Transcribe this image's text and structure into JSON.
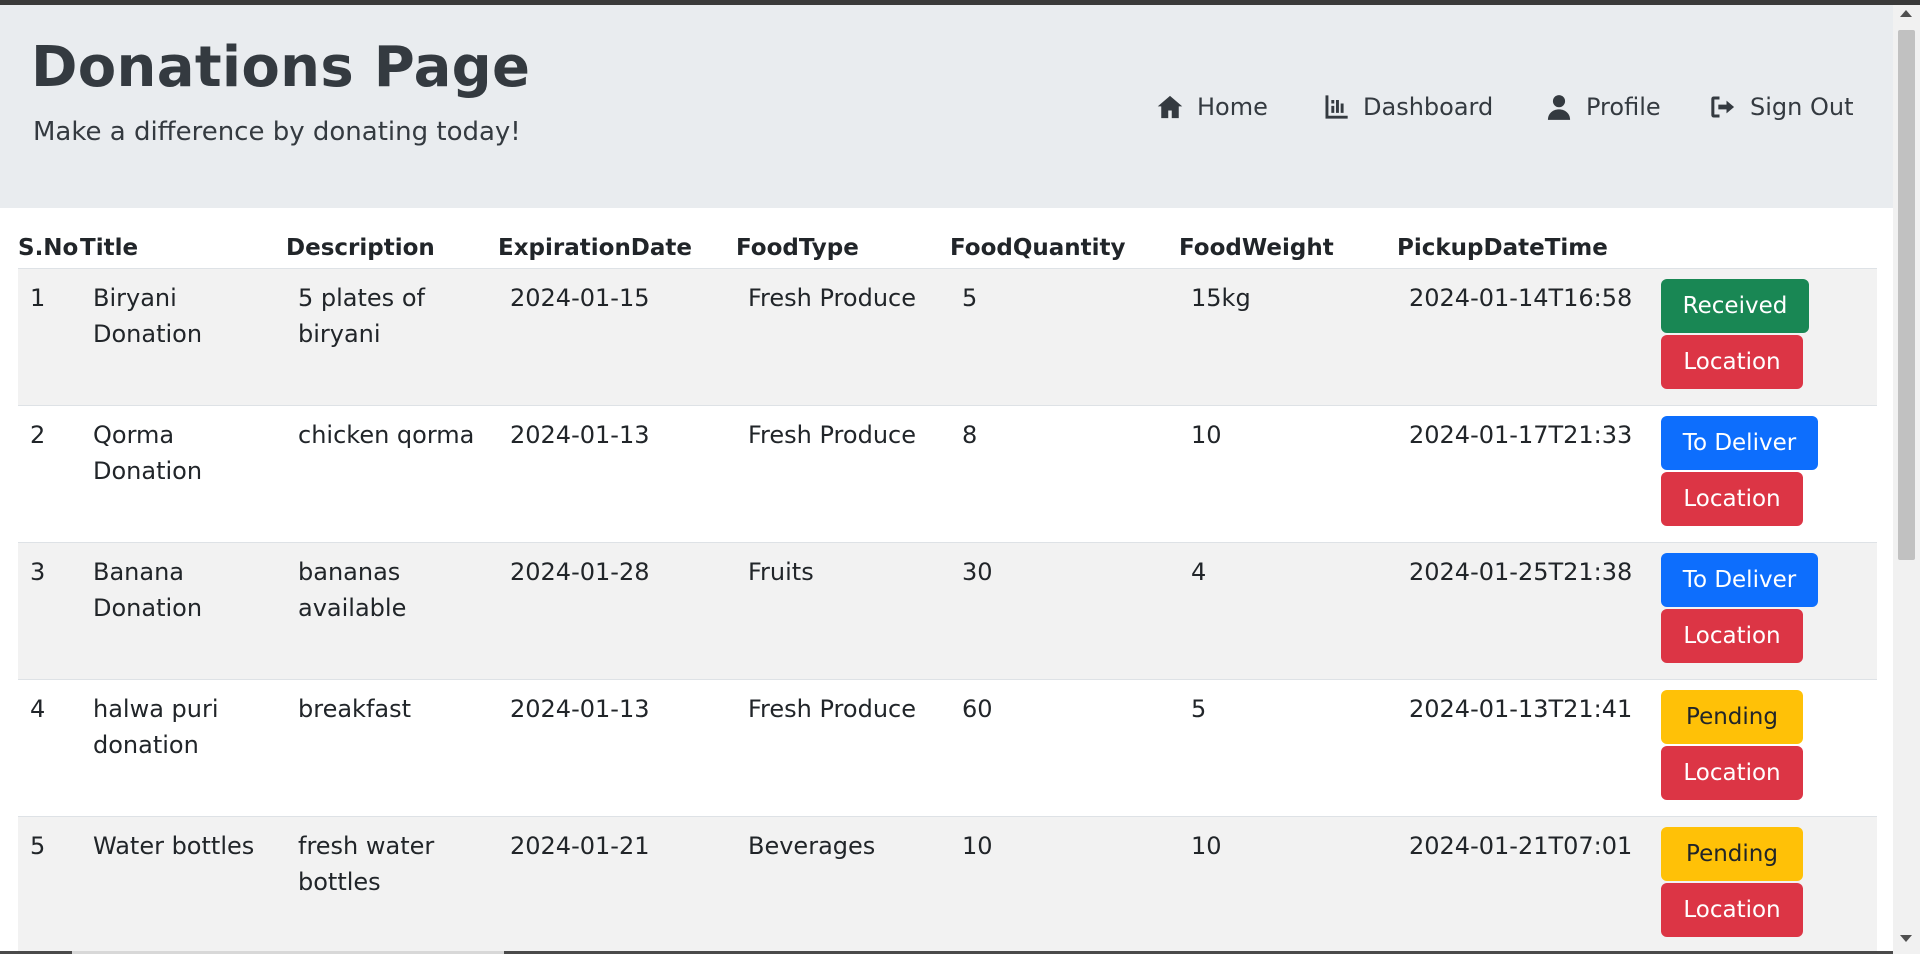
{
  "header": {
    "title": "Donations Page",
    "subtitle": "Make a difference by donating today!"
  },
  "nav": {
    "home": "Home",
    "dashboard": "Dashboard",
    "profile": "Profile",
    "signout": "Sign Out",
    "icons": [
      "home-icon",
      "chart-icon",
      "user-icon",
      "sign-out-icon"
    ]
  },
  "table": {
    "headers": [
      "S.No",
      "Title",
      "Description",
      "ExpirationDate",
      "FoodType",
      "FoodQuantity",
      "FoodWeight",
      "PickupDateTime"
    ],
    "rows": [
      {
        "sno": "1",
        "title": "Biryani Donation",
        "description": "5 plates of biryani",
        "expiration": "2024-01-15",
        "type": "Fresh Produce",
        "quantity": "5",
        "weight": "15kg",
        "pickup": "2024-01-14T16:58",
        "status": "Received",
        "location": "Location"
      },
      {
        "sno": "2",
        "title": "Qorma Donation",
        "description": "chicken qorma",
        "expiration": "2024-01-13",
        "type": "Fresh Produce",
        "quantity": "8",
        "weight": "10",
        "pickup": "2024-01-17T21:33",
        "status": "To Deliver",
        "location": "Location"
      },
      {
        "sno": "3",
        "title": "Banana Donation",
        "description": "bananas available",
        "expiration": "2024-01-28",
        "type": "Fruits",
        "quantity": "30",
        "weight": "4",
        "pickup": "2024-01-25T21:38",
        "status": "To Deliver",
        "location": "Location"
      },
      {
        "sno": "4",
        "title": "halwa puri donation",
        "description": "breakfast",
        "expiration": "2024-01-13",
        "type": "Fresh Produce",
        "quantity": "60",
        "weight": "5",
        "pickup": "2024-01-13T21:41",
        "status": "Pending",
        "location": "Location"
      },
      {
        "sno": "5",
        "title": "Water bottles",
        "description": "fresh water bottles",
        "expiration": "2024-01-21",
        "type": "Beverages",
        "quantity": "10",
        "weight": "10",
        "pickup": "2024-01-21T07:01",
        "status": "Pending",
        "location": "Location"
      }
    ]
  },
  "colors": {
    "header_bg": "#e9ecef",
    "received": "#198754",
    "to_deliver": "#0d6efd",
    "pending": "#ffc107",
    "location": "#dc3545"
  }
}
